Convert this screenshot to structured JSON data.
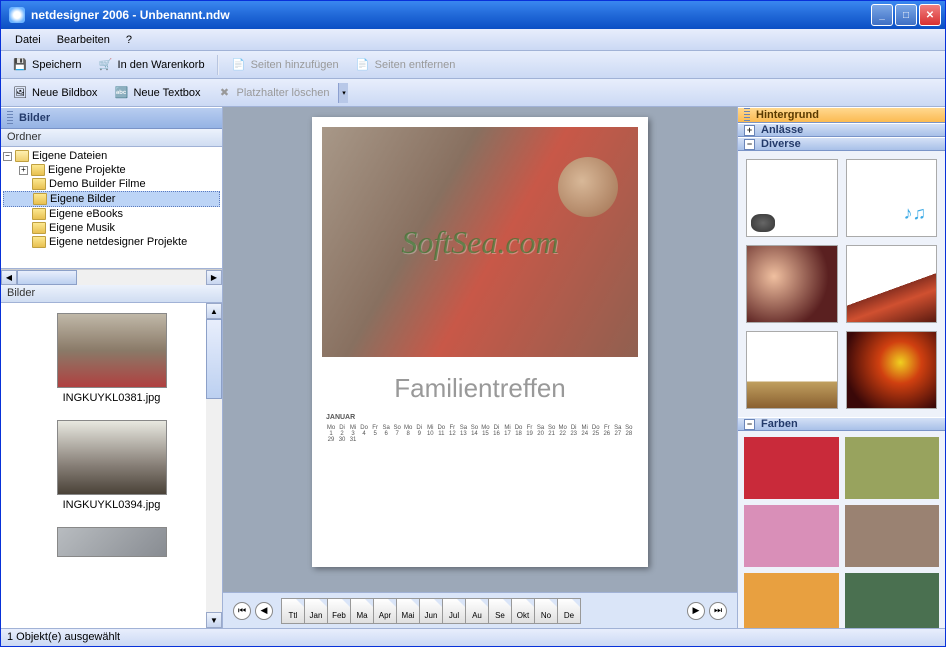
{
  "window": {
    "title": "netdesigner 2006 - Unbenannt.ndw"
  },
  "menu": {
    "file": "Datei",
    "edit": "Bearbeiten",
    "help": "?"
  },
  "toolbar1": {
    "save": "Speichern",
    "cart": "In den Warenkorb",
    "add_pages": "Seiten hinzufügen",
    "remove_pages": "Seiten entfernen"
  },
  "toolbar2": {
    "new_imgbox": "Neue Bildbox",
    "new_textbox": "Neue Textbox",
    "del_placeholder": "Platzhalter löschen"
  },
  "left": {
    "title": "Bilder",
    "folder_label": "Ordner",
    "tree": {
      "root": "Eigene Dateien",
      "items": [
        "Eigene Projekte",
        "Demo Builder Filme",
        "Eigene Bilder",
        "Eigene eBooks",
        "Eigene Musik",
        "Eigene netdesigner Projekte"
      ],
      "selected_index": 2
    },
    "bilder_label": "Bilder",
    "thumbs": [
      {
        "file": "INGKUYKL0381.jpg"
      },
      {
        "file": "INGKUYKL0394.jpg"
      }
    ]
  },
  "canvas": {
    "watermark": "SoftSea.com",
    "heading": "Familientreffen",
    "month": "JANUAR",
    "weekdays": [
      "Mo",
      "Di",
      "Mi",
      "Do",
      "Fr",
      "Sa",
      "So",
      "Mo",
      "Di",
      "Mi",
      "Do",
      "Fr",
      "Sa",
      "So",
      "Mo",
      "Di",
      "Mi",
      "Do",
      "Fr",
      "Sa",
      "So",
      "Mo",
      "Di",
      "Mi",
      "Do",
      "Fr",
      "Sa",
      "So"
    ],
    "tabs": [
      "Ttl",
      "Jan",
      "Feb",
      "Ma",
      "Apr",
      "Mai",
      "Jun",
      "Jul",
      "Au",
      "Se",
      "Okt",
      "No",
      "De"
    ]
  },
  "right": {
    "title": "Hintergrund",
    "section_anlaesse": "Anlässe",
    "section_diverse": "Diverse",
    "section_farben": "Farben",
    "colors": [
      "#c92a3a",
      "#98a35e",
      "#d98fb8",
      "#9a8272",
      "#e8a040",
      "#4a7050"
    ]
  },
  "status": "1 Objekt(e) ausgewählt"
}
